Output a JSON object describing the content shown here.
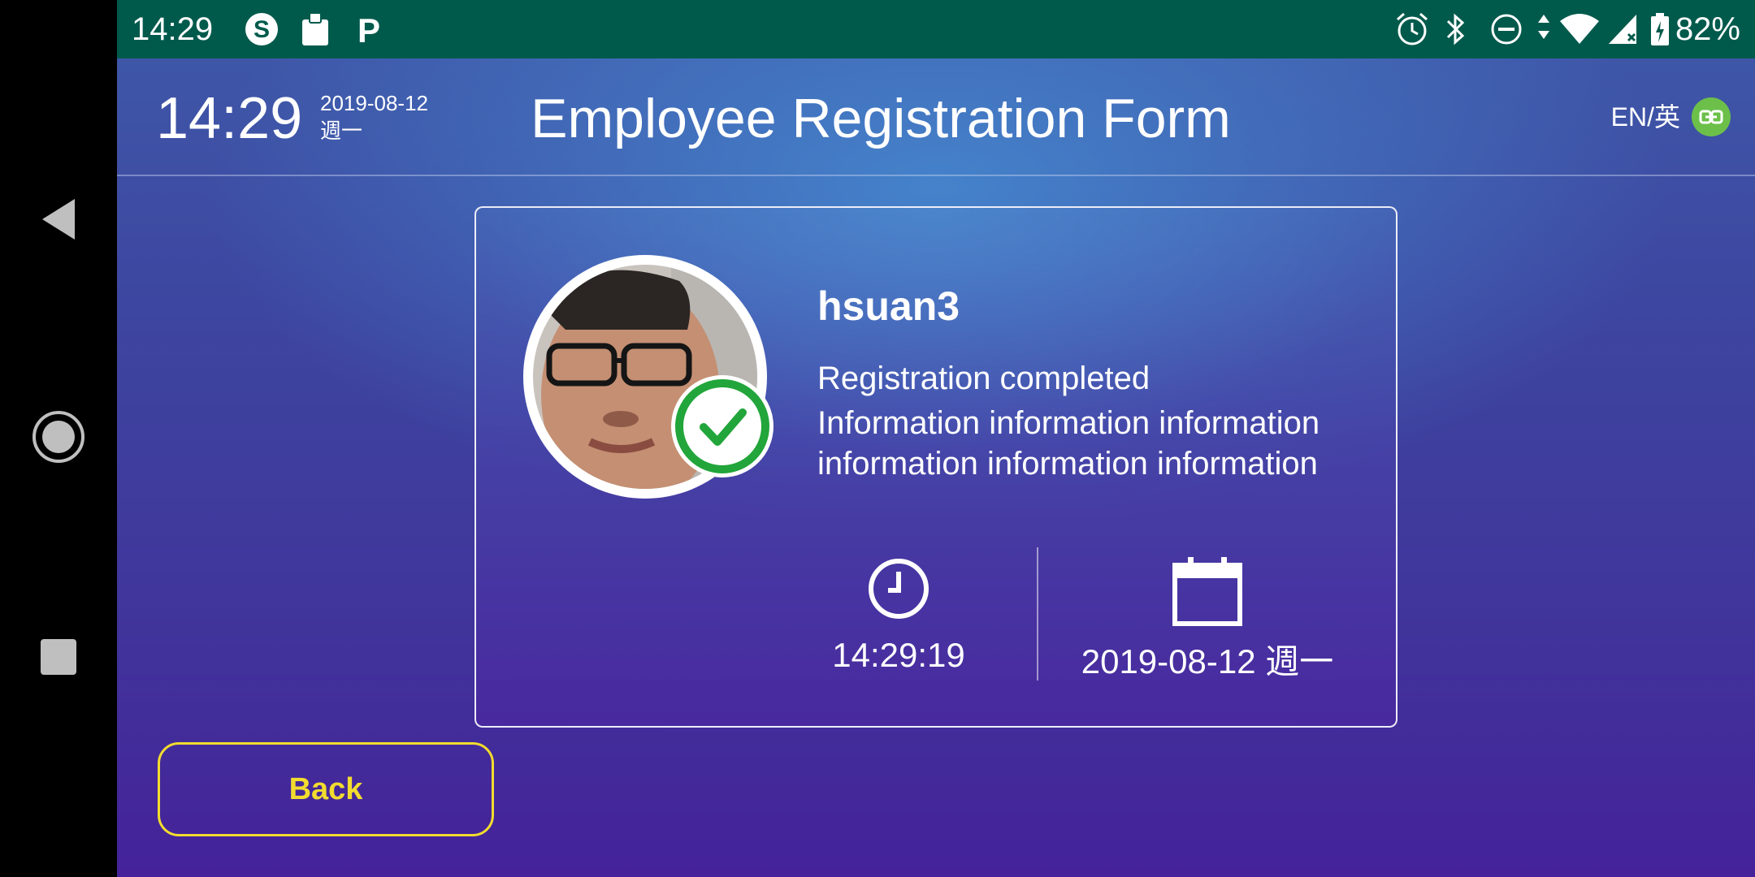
{
  "status_bar": {
    "time": "14:29",
    "battery": "82%",
    "left_icons": [
      "s-coin-icon",
      "clipboard-icon",
      "parking-icon"
    ],
    "right_icons": [
      "alarm-icon",
      "bluetooth-icon",
      "dnd-icon",
      "data-arrows-icon",
      "wifi-icon",
      "signal-icon",
      "battery-icon"
    ]
  },
  "header": {
    "time": "14:29",
    "date": "2019-08-12",
    "weekday": "週一",
    "title": "Employee Registration Form",
    "language": "EN/英"
  },
  "card": {
    "username": "hsuan3",
    "status": "Registration completed",
    "info": "Information information information information information information",
    "clock_value": "14:29:19",
    "date_value": "2019-08-12 週一"
  },
  "actions": {
    "back_label": "Back"
  },
  "colors": {
    "status_bar": "#005a4c",
    "accent_yellow": "#f2dc2e",
    "success_green": "#22a53a",
    "lang_badge": "#6cc04a"
  }
}
